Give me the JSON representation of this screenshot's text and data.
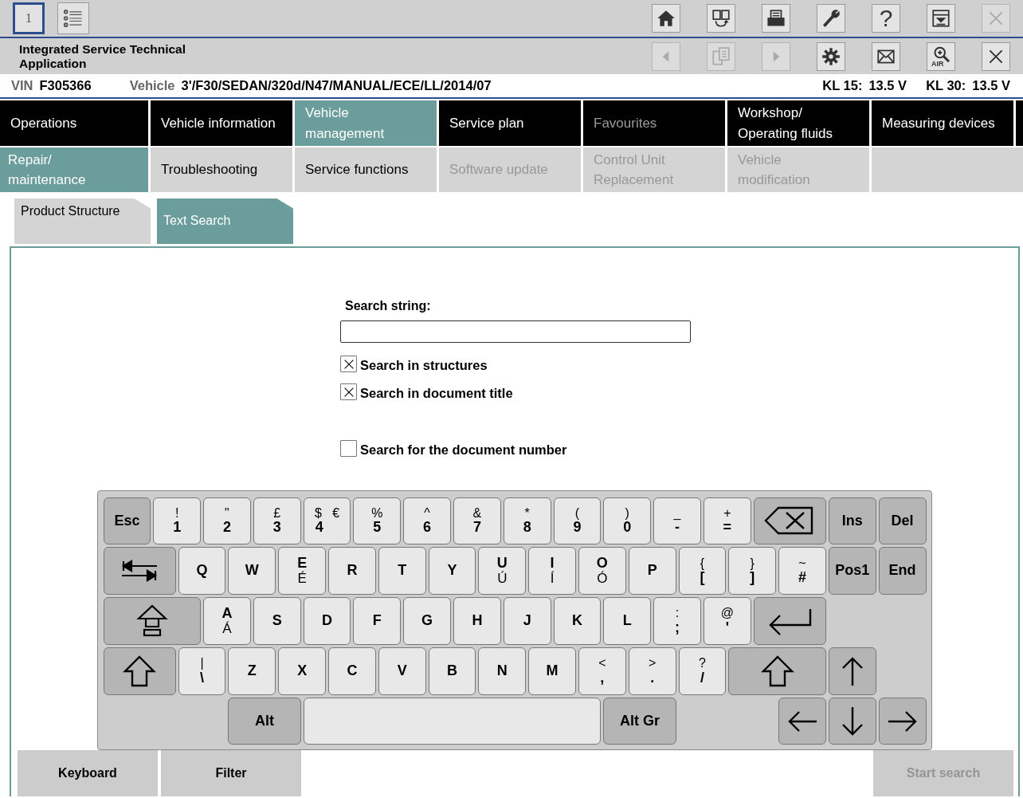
{
  "views": [
    {
      "kind": "number",
      "label": "1",
      "selected": true
    },
    {
      "kind": "list",
      "selected": false
    }
  ],
  "toolbar_top": [
    {
      "kind": "home",
      "disabled": false
    },
    {
      "kind": "screens",
      "disabled": false
    },
    {
      "kind": "printer",
      "disabled": false
    },
    {
      "kind": "wrench",
      "disabled": false
    },
    {
      "kind": "help",
      "label": "?",
      "disabled": false
    },
    {
      "kind": "tray",
      "disabled": false
    },
    {
      "kind": "close",
      "disabled": true
    }
  ],
  "app_title": "Integrated Service Technical Application",
  "toolbar_bottom": [
    {
      "kind": "back",
      "disabled": true
    },
    {
      "kind": "documents",
      "disabled": true
    },
    {
      "kind": "forward",
      "disabled": true
    },
    {
      "kind": "gear",
      "disabled": false
    },
    {
      "kind": "mail",
      "disabled": false
    },
    {
      "kind": "air",
      "label": "AIR",
      "disabled": false
    },
    {
      "kind": "close",
      "disabled": false
    }
  ],
  "vehicle_bar": {
    "vin_label": "VIN",
    "vin": "F305366",
    "vehicle_label": "Vehicle",
    "vehicle": "3'/F30/SEDAN/320d/N47/MANUAL/ECE/LL/2014/07",
    "kl15_label": "KL 15:",
    "kl15": "13.5 V",
    "kl30_label": "KL 30:",
    "kl30": "13.5 V"
  },
  "main_tabs": [
    {
      "label": "Operations",
      "selected": false,
      "disabled": false
    },
    {
      "label": "Vehicle information",
      "selected": false,
      "disabled": false
    },
    {
      "label": "Vehicle management",
      "selected": true,
      "disabled": false
    },
    {
      "label": "Service plan",
      "selected": false,
      "disabled": false
    },
    {
      "label": "Favourites",
      "selected": false,
      "disabled": true
    },
    {
      "label": "Workshop/ Operating fluids",
      "selected": false,
      "disabled": false
    },
    {
      "label": "Measuring devices",
      "selected": false,
      "disabled": false
    }
  ],
  "sub_tabs": [
    {
      "label": "Repair/ maintenance",
      "selected": true,
      "disabled": false
    },
    {
      "label": "Troubleshooting",
      "selected": false,
      "disabled": false
    },
    {
      "label": "Service functions",
      "selected": false,
      "disabled": false
    },
    {
      "label": "Software update",
      "selected": false,
      "disabled": true
    },
    {
      "label": "Control Unit Replacement",
      "selected": false,
      "disabled": true
    },
    {
      "label": "Vehicle modification",
      "selected": false,
      "disabled": true
    }
  ],
  "view_tabs": [
    {
      "label": "Product Structure",
      "selected": false
    },
    {
      "label": "Text Search",
      "selected": true
    }
  ],
  "form": {
    "search_label": "Search string:",
    "options": [
      {
        "label": "Search in structures",
        "checked": true
      },
      {
        "label": "Search in document title",
        "checked": true
      }
    ],
    "document_number": {
      "label": "Search for the document number",
      "checked": false
    }
  },
  "keyboard": {
    "rows": [
      {
        "keys": [
          {
            "kind": "text",
            "label": "Esc"
          },
          {
            "kind": "symbol",
            "shifted": "!",
            "base": "1"
          },
          {
            "kind": "symbol",
            "shifted": "\"",
            "base": "2"
          },
          {
            "kind": "symbol",
            "shifted": "£",
            "base": "3"
          },
          {
            "kind": "symbol",
            "shifted": "$",
            "altgr": "€",
            "base": "4"
          },
          {
            "kind": "symbol",
            "shifted": "%",
            "base": "5"
          },
          {
            "kind": "symbol",
            "shifted": "^",
            "base": "6"
          },
          {
            "kind": "symbol",
            "shifted": "&",
            "base": "7"
          },
          {
            "kind": "symbol",
            "shifted": "*",
            "base": "8"
          },
          {
            "kind": "symbol",
            "shifted": "(",
            "base": "9"
          },
          {
            "kind": "symbol",
            "shifted": ")",
            "base": "0"
          },
          {
            "kind": "symbol",
            "shifted": "_",
            "base": "-"
          },
          {
            "kind": "symbol",
            "shifted": "+",
            "base": "="
          },
          {
            "kind": "backspace"
          },
          {
            "kind": "text",
            "label": "Ins"
          },
          {
            "kind": "text",
            "label": "Del"
          }
        ]
      },
      {
        "keys": [
          {
            "kind": "tab"
          },
          {
            "kind": "letter",
            "label": "Q"
          },
          {
            "kind": "letter",
            "label": "W"
          },
          {
            "kind": "letter",
            "label": "E",
            "accent": "É"
          },
          {
            "kind": "letter",
            "label": "R"
          },
          {
            "kind": "letter",
            "label": "T"
          },
          {
            "kind": "letter",
            "label": "Y"
          },
          {
            "kind": "letter",
            "label": "U",
            "accent": "Ú"
          },
          {
            "kind": "letter",
            "label": "I",
            "accent": "Í"
          },
          {
            "kind": "letter",
            "label": "O",
            "accent": "Ó"
          },
          {
            "kind": "letter",
            "label": "P"
          },
          {
            "kind": "symbol",
            "shifted": "{",
            "base": "["
          },
          {
            "kind": "symbol",
            "shifted": "}",
            "base": "]"
          },
          {
            "kind": "symbol",
            "shifted": "~",
            "base": "#"
          },
          {
            "kind": "text",
            "label": "Pos1"
          },
          {
            "kind": "text",
            "label": "End"
          }
        ]
      },
      {
        "keys": [
          {
            "kind": "capslock"
          },
          {
            "kind": "letter",
            "label": "A",
            "accent": "Á"
          },
          {
            "kind": "letter",
            "label": "S"
          },
          {
            "kind": "letter",
            "label": "D"
          },
          {
            "kind": "letter",
            "label": "F"
          },
          {
            "kind": "letter",
            "label": "G"
          },
          {
            "kind": "letter",
            "label": "H"
          },
          {
            "kind": "letter",
            "label": "J"
          },
          {
            "kind": "letter",
            "label": "K"
          },
          {
            "kind": "letter",
            "label": "L"
          },
          {
            "kind": "symbol",
            "shifted": ":",
            "base": ";"
          },
          {
            "kind": "symbol",
            "shifted": "@",
            "base": "'"
          },
          {
            "kind": "enter"
          }
        ]
      },
      {
        "keys": [
          {
            "kind": "shift"
          },
          {
            "kind": "symbol",
            "shifted": "|",
            "base": "\\"
          },
          {
            "kind": "letter",
            "label": "Z"
          },
          {
            "kind": "letter",
            "label": "X"
          },
          {
            "kind": "letter",
            "label": "C"
          },
          {
            "kind": "letter",
            "label": "V"
          },
          {
            "kind": "letter",
            "label": "B"
          },
          {
            "kind": "letter",
            "label": "N"
          },
          {
            "kind": "letter",
            "label": "M"
          },
          {
            "kind": "symbol",
            "shifted": "<",
            "base": ","
          },
          {
            "kind": "symbol",
            "shifted": ">",
            "base": "."
          },
          {
            "kind": "symbol",
            "shifted": "?",
            "base": "/"
          },
          {
            "kind": "shift"
          },
          {
            "kind": "up"
          }
        ]
      },
      {
        "keys": [
          {
            "kind": "text",
            "label": "Alt"
          },
          {
            "kind": "space"
          },
          {
            "kind": "text",
            "label": "Alt Gr"
          },
          {
            "kind": "left"
          },
          {
            "kind": "down"
          },
          {
            "kind": "right"
          }
        ]
      }
    ]
  },
  "bottom_buttons": [
    {
      "label": "Keyboard",
      "disabled": false
    },
    {
      "label": "Filter",
      "disabled": false
    },
    {
      "label": "Start search",
      "disabled": true
    }
  ]
}
